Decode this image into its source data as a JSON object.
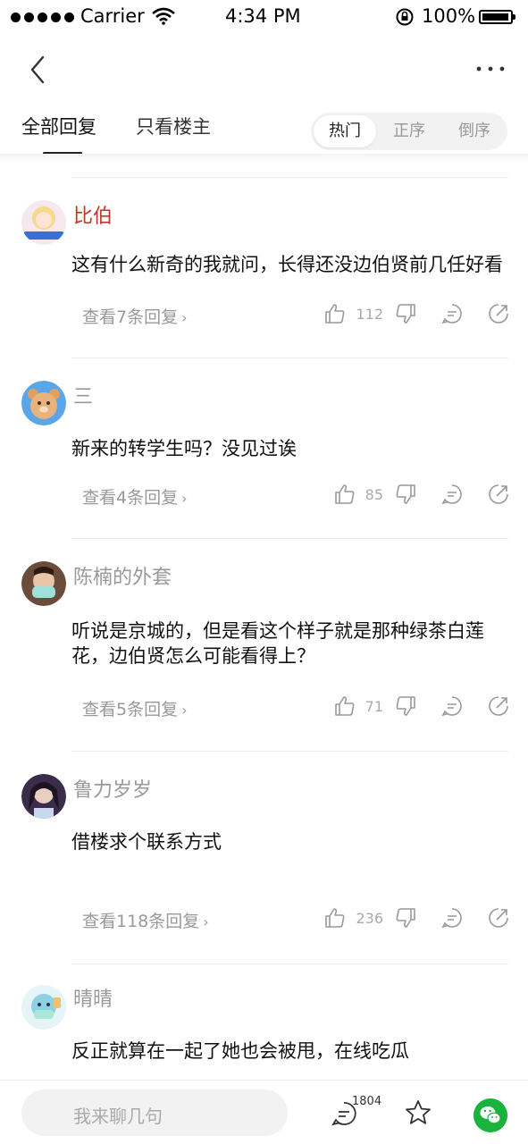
{
  "status_bar": {
    "carrier": "Carrier",
    "time": "4:34 PM",
    "battery": "100%"
  },
  "tabs": {
    "all": "全部回复",
    "owner_only": "只看楼主"
  },
  "sort": {
    "hot": "热门",
    "asc": "正序",
    "desc": "倒序"
  },
  "comments": [
    {
      "username": "比伯",
      "text": "这有什么新奇的我就问，长得还没边伯贤前几任好看",
      "replies": "查看7条回复",
      "likes": "112"
    },
    {
      "username": "三",
      "text": "新来的转学生吗？没见过诶",
      "replies": "查看4条回复",
      "likes": "85"
    },
    {
      "username": "陈楠的外套",
      "text": "听说是京城的，但是看这个样子就是那种绿茶白莲花，边伯贤怎么可能看得上？",
      "replies": "查看5条回复",
      "likes": "71"
    },
    {
      "username": "鲁力岁岁",
      "text": "借楼求个联系方式",
      "replies": "查看118条回复",
      "likes": "236"
    },
    {
      "username": "晴晴",
      "text": "反正就算在一起了她也会被甩，在线吃瓜",
      "replies": "",
      "likes": ""
    }
  ],
  "bottom_bar": {
    "input_placeholder": "我来聊几句",
    "comment_count": "1804"
  },
  "colors": {
    "vip_name": "#c0362c",
    "wechat": "#19b33d"
  },
  "icons": [
    "back-icon",
    "more-icon",
    "thumbs-up-icon",
    "thumbs-down-icon",
    "reply-icon",
    "share-icon",
    "comment-icon",
    "star-icon",
    "wechat-icon"
  ]
}
